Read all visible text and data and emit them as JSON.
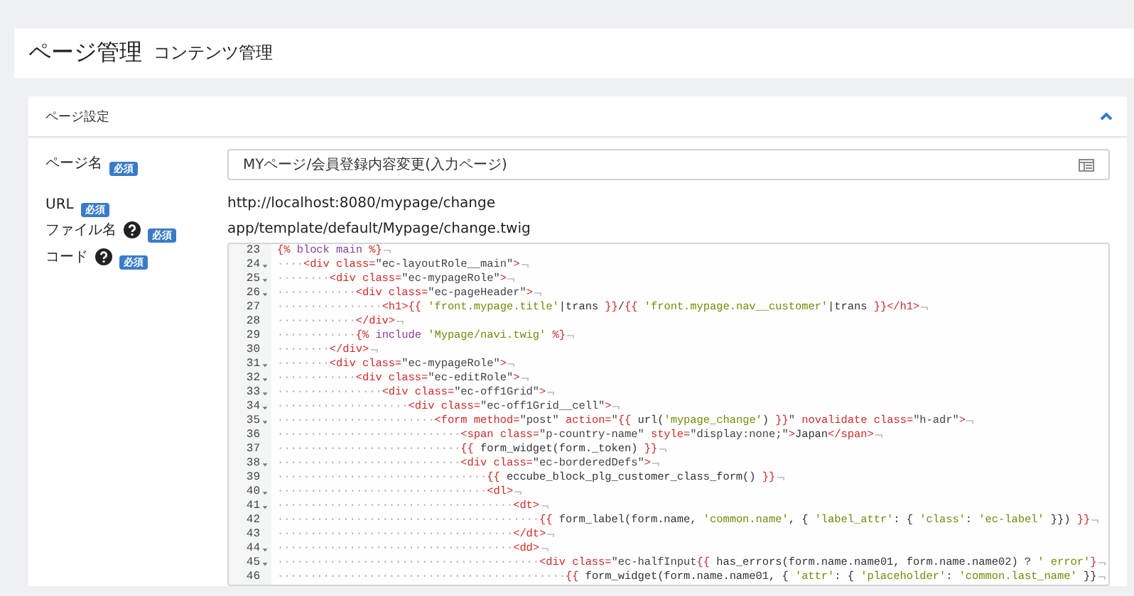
{
  "header": {
    "title": "ページ管理",
    "subtitle": "コンテンツ管理"
  },
  "card": {
    "title": "ページ設定",
    "expanded": true
  },
  "fields": [
    {
      "kind": "input",
      "label": "ページ名",
      "help": false,
      "badge": "必須",
      "value": "MYページ/会員登録内容変更(入力ページ)"
    },
    {
      "kind": "text",
      "label": "URL",
      "help": false,
      "badge": "必須",
      "value": "http://localhost:8080/mypage/change"
    },
    {
      "kind": "text",
      "label": "ファイル名",
      "help": true,
      "badge": "必須",
      "value": "app/template/default/Mypage/change.twig"
    },
    {
      "kind": "code",
      "label": "コード",
      "help": true,
      "badge": "必須",
      "lines": [
        {
          "number": "23",
          "fold": false,
          "segments": [
            {
              "kind": "tag",
              "text": "{% "
            },
            {
              "kind": "keyword",
              "text": "block main"
            },
            {
              "kind": "tag",
              "text": " %}"
            }
          ]
        },
        {
          "number": "24",
          "fold": true,
          "segments": [
            {
              "kind": "indent",
              "text": "····"
            },
            {
              "kind": "tag",
              "text": "<div class="
            },
            {
              "kind": "value",
              "text": "\"ec-layoutRole__main\""
            },
            {
              "kind": "tag",
              "text": ">"
            }
          ]
        },
        {
          "number": "25",
          "fold": true,
          "segments": [
            {
              "kind": "indent",
              "text": "········"
            },
            {
              "kind": "tag",
              "text": "<div class="
            },
            {
              "kind": "value",
              "text": "\"ec-mypageRole\""
            },
            {
              "kind": "tag",
              "text": ">"
            }
          ]
        },
        {
          "number": "26",
          "fold": true,
          "segments": [
            {
              "kind": "indent",
              "text": "············"
            },
            {
              "kind": "tag",
              "text": "<div class="
            },
            {
              "kind": "value",
              "text": "\"ec-pageHeader\""
            },
            {
              "kind": "tag",
              "text": ">"
            }
          ]
        },
        {
          "number": "27",
          "fold": false,
          "segments": [
            {
              "kind": "indent",
              "text": "················"
            },
            {
              "kind": "tag",
              "text": "<h1>{{ "
            },
            {
              "kind": "string",
              "text": "'front.mypage.title'"
            },
            {
              "kind": "plain",
              "text": "|trans "
            },
            {
              "kind": "tag",
              "text": "}}"
            },
            {
              "kind": "plain",
              "text": "/"
            },
            {
              "kind": "tag",
              "text": "{{ "
            },
            {
              "kind": "string",
              "text": "'front.mypage.nav__customer'"
            },
            {
              "kind": "plain",
              "text": "|trans "
            },
            {
              "kind": "tag",
              "text": "}}</h1>"
            }
          ]
        },
        {
          "number": "28",
          "fold": false,
          "segments": [
            {
              "kind": "indent",
              "text": "············"
            },
            {
              "kind": "tag",
              "text": "</div>"
            }
          ]
        },
        {
          "number": "29",
          "fold": false,
          "segments": [
            {
              "kind": "indent",
              "text": "············"
            },
            {
              "kind": "tag",
              "text": "{% "
            },
            {
              "kind": "keyword",
              "text": "include "
            },
            {
              "kind": "string",
              "text": "'Mypage/navi.twig'"
            },
            {
              "kind": "tag",
              "text": " %}"
            }
          ]
        },
        {
          "number": "30",
          "fold": false,
          "segments": [
            {
              "kind": "indent",
              "text": "········"
            },
            {
              "kind": "tag",
              "text": "</div>"
            }
          ]
        },
        {
          "number": "31",
          "fold": true,
          "segments": [
            {
              "kind": "indent",
              "text": "········"
            },
            {
              "kind": "tag",
              "text": "<div class="
            },
            {
              "kind": "value",
              "text": "\"ec-mypageRole\""
            },
            {
              "kind": "tag",
              "text": ">"
            }
          ]
        },
        {
          "number": "32",
          "fold": true,
          "segments": [
            {
              "kind": "indent",
              "text": "············"
            },
            {
              "kind": "tag",
              "text": "<div class="
            },
            {
              "kind": "value",
              "text": "\"ec-editRole\""
            },
            {
              "kind": "tag",
              "text": ">"
            }
          ]
        },
        {
          "number": "33",
          "fold": true,
          "segments": [
            {
              "kind": "indent",
              "text": "················"
            },
            {
              "kind": "tag",
              "text": "<div class="
            },
            {
              "kind": "value",
              "text": "\"ec-off1Grid\""
            },
            {
              "kind": "tag",
              "text": ">"
            }
          ]
        },
        {
          "number": "34",
          "fold": true,
          "segments": [
            {
              "kind": "indent",
              "text": "····················"
            },
            {
              "kind": "tag",
              "text": "<div class="
            },
            {
              "kind": "value",
              "text": "\"ec-off1Grid__cell\""
            },
            {
              "kind": "tag",
              "text": ">"
            }
          ]
        },
        {
          "number": "35",
          "fold": true,
          "segments": [
            {
              "kind": "indent",
              "text": "························"
            },
            {
              "kind": "tag",
              "text": "<form method="
            },
            {
              "kind": "value",
              "text": "\"post\""
            },
            {
              "kind": "tag",
              "text": " action="
            },
            {
              "kind": "value",
              "text": "\""
            },
            {
              "kind": "tag",
              "text": "{{ "
            },
            {
              "kind": "plain",
              "text": "url("
            },
            {
              "kind": "string",
              "text": "'mypage_change'"
            },
            {
              "kind": "plain",
              "text": ") "
            },
            {
              "kind": "tag",
              "text": "}}"
            },
            {
              "kind": "value",
              "text": "\""
            },
            {
              "kind": "tag",
              "text": " novalidate class="
            },
            {
              "kind": "value",
              "text": "\"h-adr\""
            },
            {
              "kind": "tag",
              "text": ">"
            }
          ]
        },
        {
          "number": "36",
          "fold": false,
          "segments": [
            {
              "kind": "indent",
              "text": "····························"
            },
            {
              "kind": "tag",
              "text": "<span class="
            },
            {
              "kind": "value",
              "text": "\"p-country-name\""
            },
            {
              "kind": "tag",
              "text": " style="
            },
            {
              "kind": "value",
              "text": "\"display:none;\""
            },
            {
              "kind": "tag",
              "text": ">"
            },
            {
              "kind": "plain",
              "text": "Japan"
            },
            {
              "kind": "tag",
              "text": "</span>"
            }
          ]
        },
        {
          "number": "37",
          "fold": false,
          "segments": [
            {
              "kind": "indent",
              "text": "····························"
            },
            {
              "kind": "tag",
              "text": "{{ "
            },
            {
              "kind": "plain",
              "text": "form_widget(form._token) "
            },
            {
              "kind": "tag",
              "text": "}}"
            }
          ]
        },
        {
          "number": "38",
          "fold": true,
          "segments": [
            {
              "kind": "indent",
              "text": "····························"
            },
            {
              "kind": "tag",
              "text": "<div class="
            },
            {
              "kind": "value",
              "text": "\"ec-borderedDefs\""
            },
            {
              "kind": "tag",
              "text": ">"
            }
          ]
        },
        {
          "number": "39",
          "fold": false,
          "segments": [
            {
              "kind": "indent",
              "text": "································"
            },
            {
              "kind": "tag",
              "text": "{{ "
            },
            {
              "kind": "plain",
              "text": "eccube_block_plg_customer_class_form() "
            },
            {
              "kind": "tag",
              "text": "}}"
            }
          ]
        },
        {
          "number": "40",
          "fold": true,
          "segments": [
            {
              "kind": "indent",
              "text": "································"
            },
            {
              "kind": "tag",
              "text": "<dl>"
            }
          ]
        },
        {
          "number": "41",
          "fold": true,
          "segments": [
            {
              "kind": "indent",
              "text": "····································"
            },
            {
              "kind": "tag",
              "text": "<dt>"
            }
          ]
        },
        {
          "number": "42",
          "fold": false,
          "segments": [
            {
              "kind": "indent",
              "text": "········································"
            },
            {
              "kind": "tag",
              "text": "{{ "
            },
            {
              "kind": "plain",
              "text": "form_label(form.name, "
            },
            {
              "kind": "string",
              "text": "'common.name'"
            },
            {
              "kind": "plain",
              "text": ", { "
            },
            {
              "kind": "string",
              "text": "'label_attr'"
            },
            {
              "kind": "plain",
              "text": ": { "
            },
            {
              "kind": "string",
              "text": "'class'"
            },
            {
              "kind": "plain",
              "text": ": "
            },
            {
              "kind": "string",
              "text": "'ec-label'"
            },
            {
              "kind": "plain",
              "text": " }}) "
            },
            {
              "kind": "tag",
              "text": "}}"
            }
          ]
        },
        {
          "number": "43",
          "fold": false,
          "segments": [
            {
              "kind": "indent",
              "text": "····································"
            },
            {
              "kind": "tag",
              "text": "</dt>"
            }
          ]
        },
        {
          "number": "44",
          "fold": true,
          "segments": [
            {
              "kind": "indent",
              "text": "····································"
            },
            {
              "kind": "tag",
              "text": "<dd>"
            }
          ]
        },
        {
          "number": "45",
          "fold": true,
          "segments": [
            {
              "kind": "indent",
              "text": "········································"
            },
            {
              "kind": "tag",
              "text": "<div class="
            },
            {
              "kind": "value",
              "text": "\"ec-halfInput"
            },
            {
              "kind": "tag",
              "text": "{{ "
            },
            {
              "kind": "plain",
              "text": "has_errors(form.name.name01, form.name.name02) ? "
            },
            {
              "kind": "string",
              "text": "' error'"
            },
            {
              "kind": "tag",
              "text": "}"
            }
          ]
        },
        {
          "number": "46",
          "fold": false,
          "segments": [
            {
              "kind": "indent",
              "text": "············································"
            },
            {
              "kind": "tag",
              "text": "{{ "
            },
            {
              "kind": "plain",
              "text": "form_widget(form.name.name01, { "
            },
            {
              "kind": "string",
              "text": "'attr'"
            },
            {
              "kind": "plain",
              "text": ": { "
            },
            {
              "kind": "string",
              "text": "'placeholder'"
            },
            {
              "kind": "plain",
              "text": ": "
            },
            {
              "kind": "string",
              "text": "'common.last_name'"
            },
            {
              "kind": "plain",
              "text": " }}"
            }
          ]
        }
      ]
    }
  ]
}
